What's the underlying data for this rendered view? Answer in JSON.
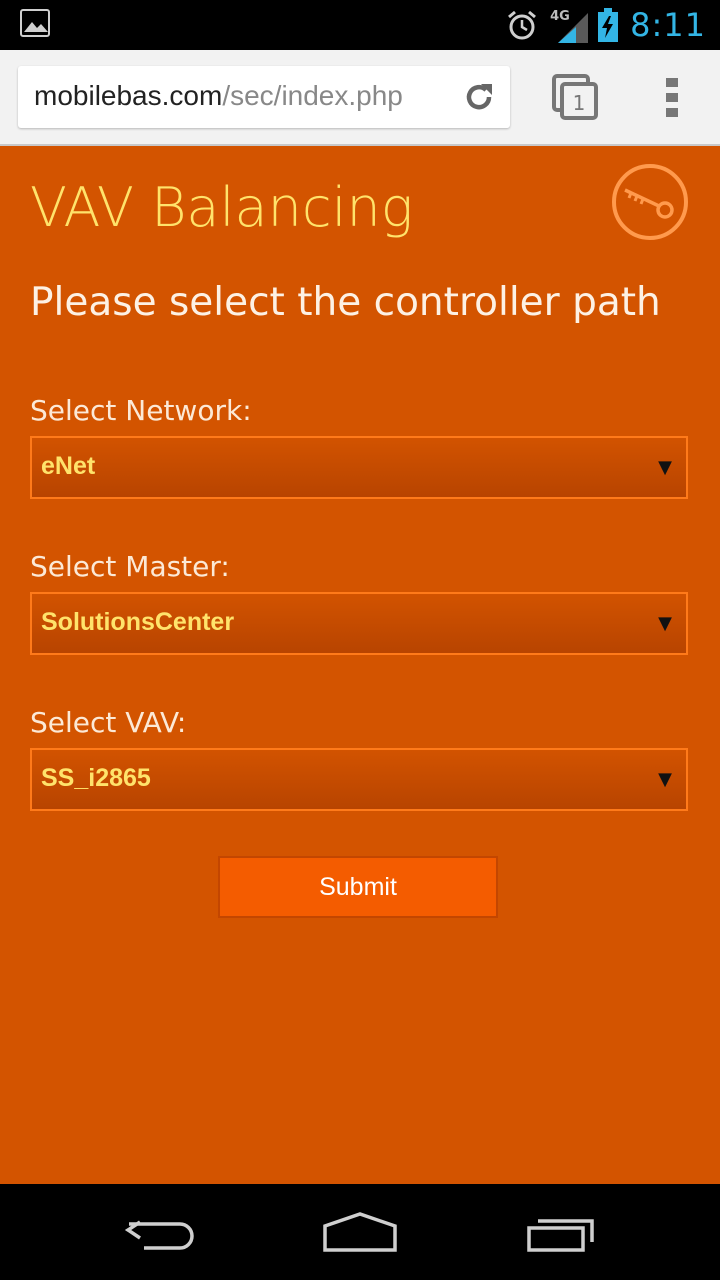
{
  "status_bar": {
    "network": "4G",
    "time": "8:11",
    "icons": [
      "gallery-icon",
      "alarm-icon",
      "signal-icon",
      "battery-charging-icon"
    ]
  },
  "browser": {
    "url_host": "mobilebas.com",
    "url_path": "/sec/index.php",
    "tab_count": "1",
    "icons": [
      "reload-icon",
      "tabs-icon",
      "overflow-menu-icon"
    ]
  },
  "page": {
    "title": "VAV Balancing",
    "subtitle": "Please select the controller path",
    "fields": [
      {
        "label": "Select Network:",
        "value": "eNet"
      },
      {
        "label": "Select Master:",
        "value": "SolutionsCenter"
      },
      {
        "label": "Select VAV:",
        "value": "SS_i2865"
      }
    ],
    "dropdown_arrow": "▼",
    "submit_label": "Submit",
    "colors": {
      "background": "#d35400",
      "title": "#ffe36b",
      "select_value": "#ffe36b",
      "submit_bg": "#f45c00",
      "status_time": "#33b5e5"
    }
  },
  "nav_bar": {
    "icons": [
      "back-icon",
      "home-icon",
      "recent-apps-icon"
    ]
  }
}
